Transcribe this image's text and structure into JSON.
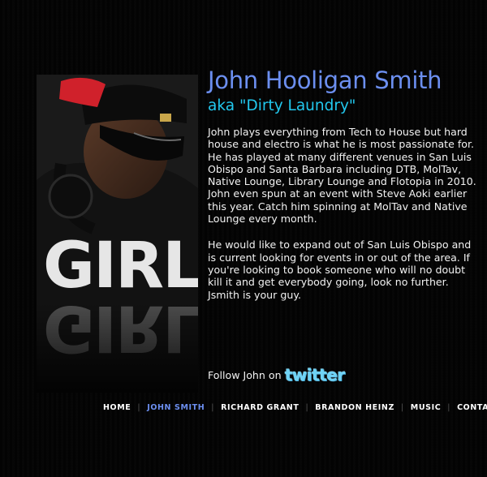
{
  "profile": {
    "name": "John Hooligan Smith",
    "aka": "aka \"Dirty Laundry\"",
    "bio": [
      "John plays everything from Tech to House but hard house and electro is what he is most passionate for. He has played at many different venues in San Luis Obispo and Santa Barbara including DTB, MolTav, Native Lounge, Library Lounge and Flotopia in 2010. John even spun at an event with Steve Aoki earlier this year. Catch him spinning at MolTav and Native Lounge every month.",
      "He would like to expand out of San Luis Obispo and is current looking for events in or out of the area. If you're looking to book someone who will no doubt kill it and get everybody going, look no further. Jsmith is your guy."
    ],
    "follow_label": "Follow John on",
    "twitter_logo_text": "twitter",
    "shirt_text": "GIRL"
  },
  "nav": {
    "items": [
      {
        "label": "HOME"
      },
      {
        "label": "JOHN SMITH"
      },
      {
        "label": "RICHARD GRANT"
      },
      {
        "label": "BRANDON HEINZ"
      },
      {
        "label": "MUSIC"
      },
      {
        "label": "CONTACT"
      }
    ],
    "separator": "|",
    "active": "JOHN SMITH"
  },
  "colors": {
    "background": "#000000",
    "name": "#6c8ff0",
    "aka": "#22c8ee",
    "body_text": "#f2f2f2",
    "nav_active": "#6c8ff0",
    "cap_brim": "#d0212b"
  }
}
